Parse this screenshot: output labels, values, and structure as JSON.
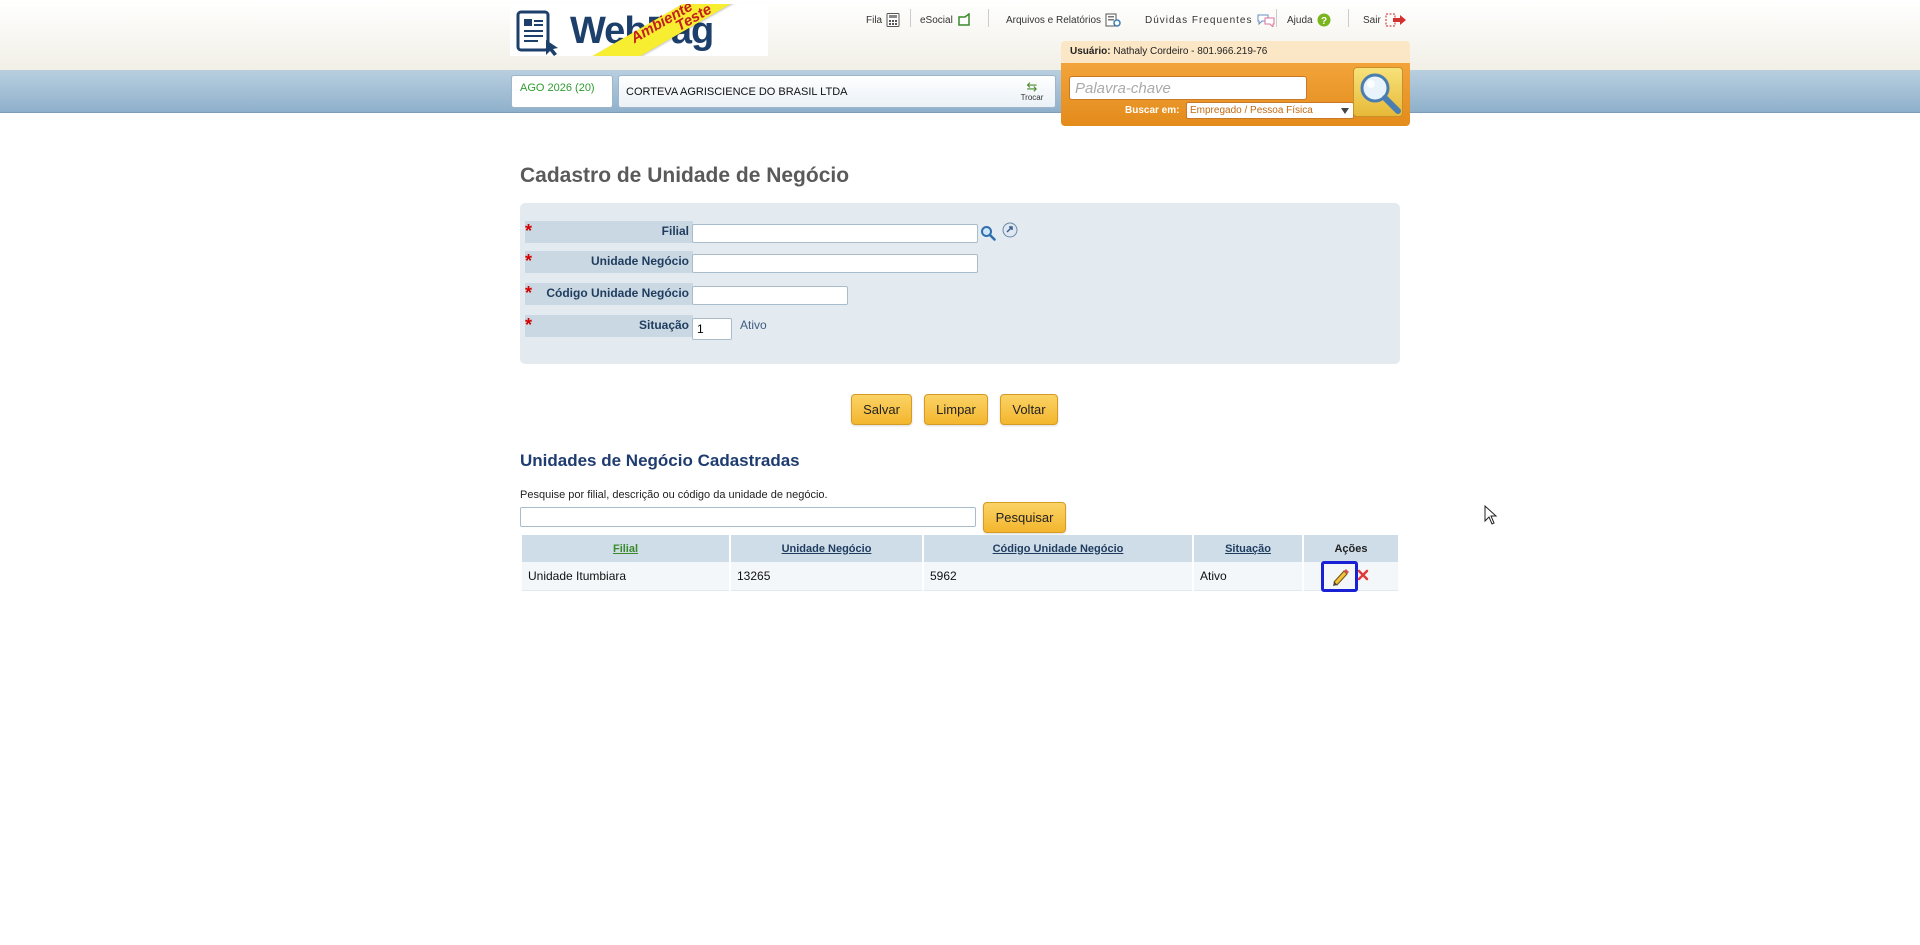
{
  "header": {
    "logo_text": "WebPag",
    "ribbon_line1": "Ambiente",
    "ribbon_line2": "Teste",
    "nav": {
      "fila": "Fila",
      "esocial": "eSocial",
      "arquivos": "Arquivos e Relatórios",
      "duvidas": "Dúvidas Frequentes",
      "ajuda": "Ajuda",
      "sair": "Sair"
    },
    "user_label": "Usuário:",
    "user_value": "Nathaly Cordeiro - 801.966.219-76",
    "period": "AGO 2026 (20)",
    "company": "CORTEVA AGRISCIENCE DO BRASIL LTDA",
    "trocar": "Trocar",
    "search_placeholder": "Palavra-chave",
    "buscar_label": "Buscar em:",
    "buscar_option": "Empregado / Pessoa Física"
  },
  "form": {
    "title": "Cadastro de Unidade de Negócio",
    "required_mark": "*",
    "fields": {
      "filial": {
        "label": "Filial",
        "value": ""
      },
      "unidade": {
        "label": "Unidade Negócio",
        "value": ""
      },
      "codigo": {
        "label": "Código Unidade Negócio",
        "value": ""
      },
      "situacao": {
        "label": "Situação",
        "value": "1",
        "desc": "Ativo"
      }
    },
    "buttons": {
      "salvar": "Salvar",
      "limpar": "Limpar",
      "voltar": "Voltar"
    }
  },
  "list": {
    "title": "Unidades de Negócio Cadastradas",
    "help": "Pesquise por filial, descrição ou código da unidade de negócio.",
    "search_value": "",
    "search_button": "Pesquisar",
    "columns": [
      "Filial",
      "Unidade Negócio",
      "Código Unidade Negócio",
      "Situação",
      "Ações"
    ],
    "rows": [
      [
        "Unidade Itumbiara",
        "13265",
        "5962",
        "Ativo"
      ]
    ]
  },
  "colors": {
    "accent_orange": "#e38b1b",
    "button_yellow": "#f3b62e",
    "title_blue": "#1f3c70",
    "highlight_border": "#1a20d4"
  }
}
